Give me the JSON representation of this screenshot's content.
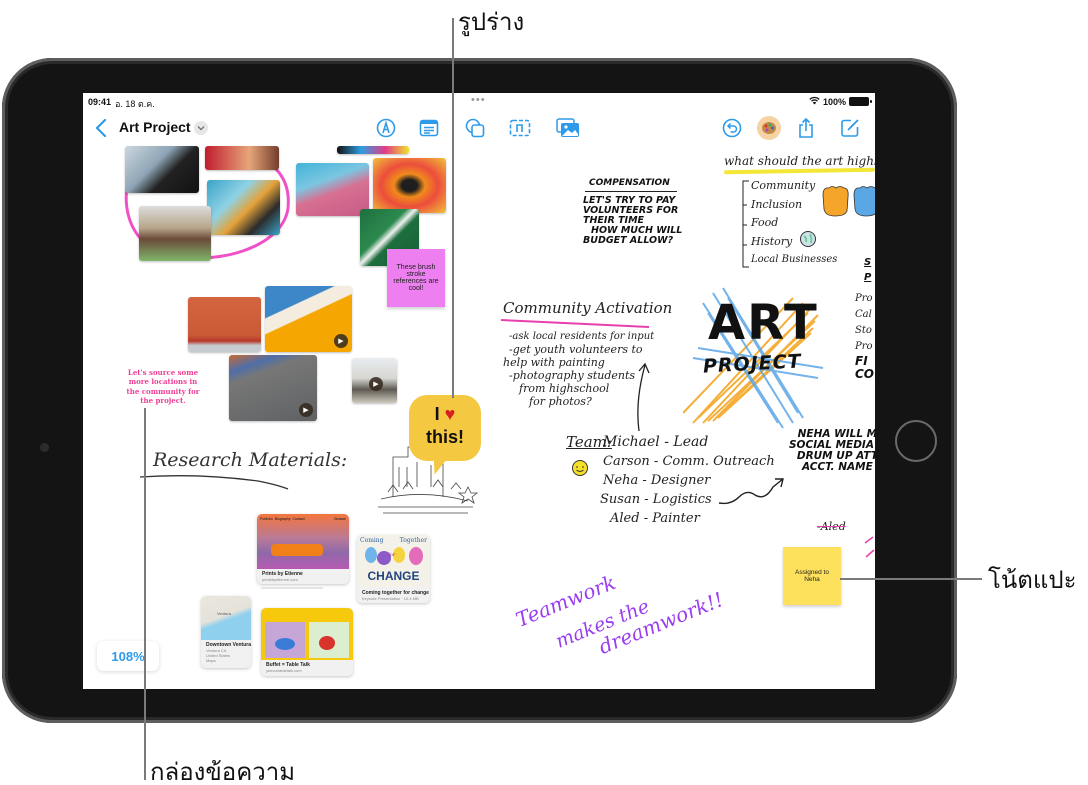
{
  "callouts": {
    "shape": "รูปร่าง",
    "sticky_note": "โน้ตแปะ",
    "text_box": "กล่องข้อความ"
  },
  "status_bar": {
    "time": "09:41",
    "date": "อ. 18 ต.ค.",
    "multitask_dots": "•••",
    "battery": "100%"
  },
  "toolbar": {
    "back_icon": "chevron-left-icon",
    "title": "Art Project",
    "title_menu_icon": "chevron-down-icon",
    "left_tools": [
      "pen-tool-icon",
      "text-box-icon"
    ],
    "center_tools": [
      "shapes-icon",
      "sticky-note-icon",
      "photos-icon"
    ],
    "right_tools": [
      "undo-icon",
      "collaborator-avatar",
      "share-icon",
      "new-board-icon"
    ]
  },
  "canvas": {
    "sticky_notes": [
      {
        "text": "These brush stroke references are cool!",
        "color": "#ee7ff0"
      },
      {
        "text": "Assigned to Neha",
        "color": "#fde15c"
      }
    ],
    "text_box": "Let's source some more locations in the community for the project.",
    "shape_speech_bubble": {
      "line1": "I",
      "heart": "♥",
      "line2": "this!"
    },
    "research_heading": "Research Materials:",
    "compensation": {
      "title": "COMPENSATION",
      "lines": [
        "LET'S TRY TO PAY",
        "VOLUNTEERS FOR",
        "THEIR TIME",
        "HOW MUCH WILL",
        "BUDGET ALLOW?"
      ]
    },
    "highlight": {
      "title": "what should the art highlight",
      "items": [
        "Community",
        "Inclusion",
        "Food",
        "History",
        "Local Businesses"
      ]
    },
    "community_activation": {
      "title": "Community Activation",
      "lines": [
        "-ask local residents for input",
        "-get youth volunteers to",
        "help with painting",
        "-photography students",
        "from highschool",
        "for photos?"
      ]
    },
    "art_logo": {
      "line1": "ART",
      "line2": "PROJECT"
    },
    "team": {
      "label": "Team:",
      "members": [
        "Michael - Lead",
        "Carson - Comm. Outreach",
        "Neha - Designer",
        "Susan - Logistics",
        "Aled - Painter"
      ]
    },
    "neha_note": [
      "NEHA WILL M",
      "SOCIAL MEDIA A",
      "DRUM UP ATT",
      "ACCT. NAME"
    ],
    "right_edge_list": [
      "S",
      "P",
      "Pro",
      "Cal",
      "Sto",
      "Pro",
      "FI",
      "CO"
    ],
    "crossed_note": "-Aled",
    "teamwork": [
      "Teamwork",
      "makes the",
      "dreamwork!!"
    ],
    "link_cards": [
      {
        "title": "Prints by Etienne",
        "subtitle": "printsbyetienne.com",
        "nav": [
          "Portfolio",
          "Biography",
          "Contact",
          "Browse"
        ]
      },
      {
        "title": "Coming together for change",
        "subtitle": "Keynote Presentation · 10.4 MB",
        "art_text": [
          "Coming",
          "Together",
          "for",
          "CHANGE"
        ]
      },
      {
        "title": "Downtown Ventura",
        "subtitle": "Ventura CA",
        "subtitle2": "United States",
        "source": "Maps",
        "map_label": "Ventura"
      },
      {
        "title": "Buffet = Table Talk",
        "subtitle": "joinourtabletalk.com"
      }
    ],
    "zoom_level": "108%"
  }
}
